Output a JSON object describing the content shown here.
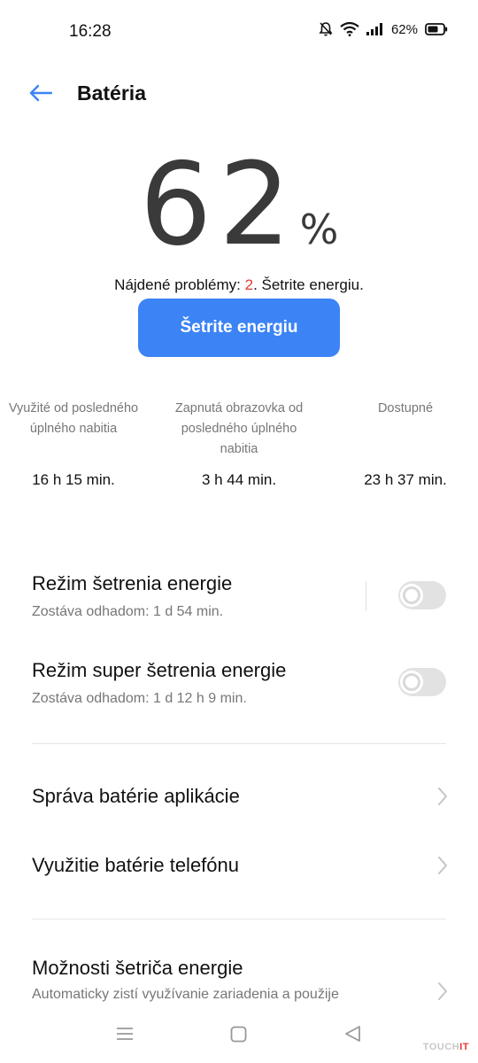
{
  "status_bar": {
    "time": "16:28",
    "battery_percent": "62%"
  },
  "header": {
    "title": "Batéria",
    "back_icon": "arrow-left-icon"
  },
  "battery": {
    "level_number": "62",
    "level_sign": "%"
  },
  "problems": {
    "prefix": "Nájdené problémy: ",
    "count": "2",
    "suffix": ". Šetrite energiu."
  },
  "save_button_label": "Šetrite energiu",
  "stats": [
    {
      "label": "Využité od posledného úplného nabitia",
      "value": "16 h 15 min."
    },
    {
      "label": "Zapnutá obrazovka od posledného úplného nabitia",
      "value": "3 h 44 min."
    },
    {
      "label": "Dostupné",
      "value": "23 h 37 min."
    }
  ],
  "settings": {
    "power_saving": {
      "title": "Režim šetrenia energie",
      "subtitle": "Zostáva odhadom:  1 d 54 min.",
      "enabled": false
    },
    "super_power_saving": {
      "title": "Režim super šetrenia energie",
      "subtitle": "Zostáva odhadom:  1 d 12 h 9 min.",
      "enabled": false
    }
  },
  "menu": {
    "app_battery": "Správa batérie aplikácie",
    "phone_battery_usage": "Využitie batérie telefónu",
    "saver_options_title": "Možnosti šetriča energie",
    "saver_options_subtitle": "Automaticky zistí využívanie zariadenia a použije"
  },
  "watermark": {
    "main": "TOUCH",
    "accent": "IT"
  },
  "colors": {
    "accent_blue": "#3c84f5",
    "problem_red": "#e53935",
    "text_secondary": "#777777"
  }
}
